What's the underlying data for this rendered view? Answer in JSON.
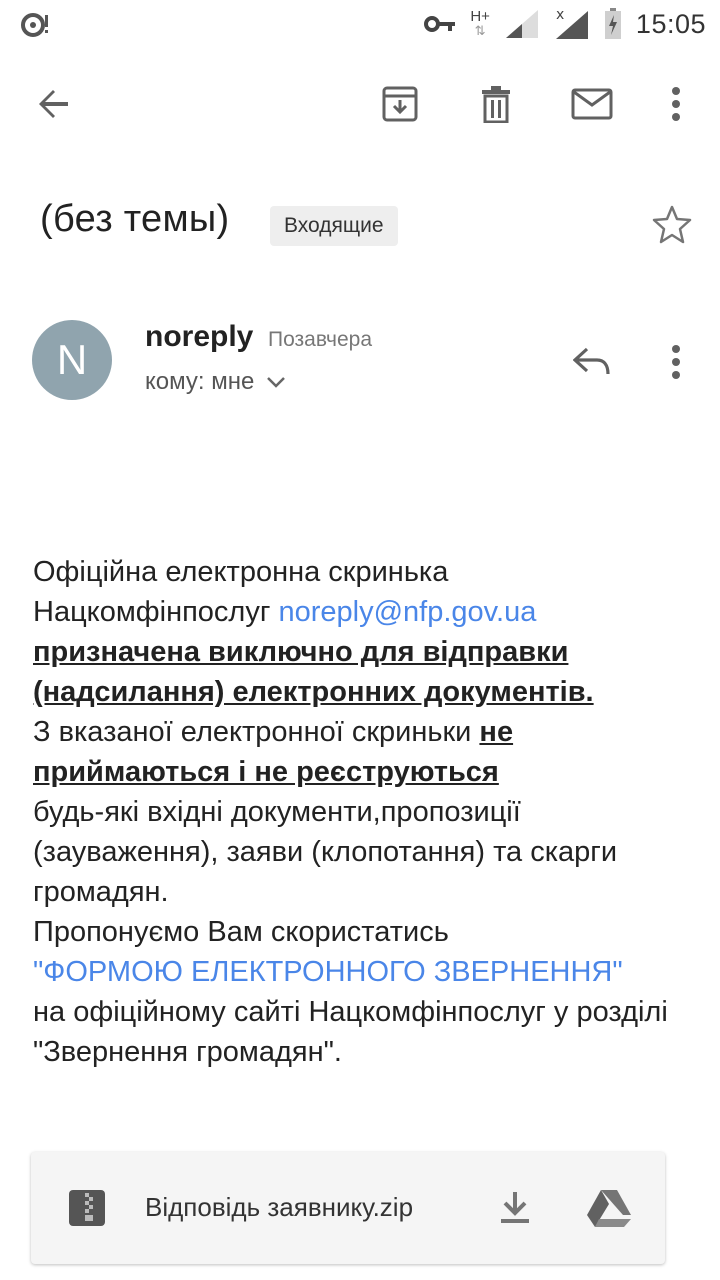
{
  "status_bar": {
    "time": "15:05",
    "network_label": "H+",
    "icons": [
      "sync-icon",
      "key-icon",
      "signal-icon",
      "no-signal-icon",
      "battery-charging-icon"
    ]
  },
  "toolbar": {
    "icons": [
      "back-arrow-icon",
      "archive-icon",
      "trash-icon",
      "mail-icon",
      "more-vert-icon"
    ]
  },
  "email": {
    "subject": "(без темы)",
    "label": "Входящие",
    "sender": {
      "avatar_letter": "N",
      "name": "noreply",
      "date": "Позавчера",
      "recipient": "кому: мне"
    },
    "body": {
      "line1": "Офіційна електронна скринька Нацкомфінпослуг",
      "email_link": "noreply@nfp.gov.ua",
      "bold_1": "призначена виключно для відправки (надсилання) електронних документів.",
      "text_2": "З вказаної електронної скриньки",
      "bold_2": "не приймаються і не реєструються",
      "text_3": "будь-які вхідні документи,пропозиції (зауваження), заяви (клопотання) та скарги громадян.",
      "text_4": "Пропонуємо Вам скористатись",
      "form_link": "\"ФОРМОЮ ЕЛЕКТРОННОГО ЗВЕРНЕННЯ\"",
      "text_5": "на офіційному сайті Нацкомфінпослуг у розділі \"Звернення громадян\"."
    },
    "attachment": {
      "filename": "Відповідь заявнику.zip"
    }
  },
  "colors": {
    "link": "#4a86e8",
    "avatar_bg": "#90a4ae",
    "icon": "#616161"
  }
}
